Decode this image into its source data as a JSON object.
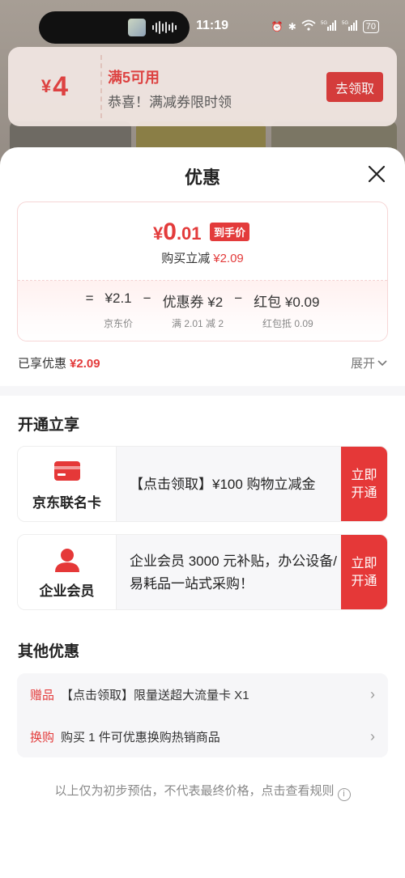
{
  "status_bar": {
    "time": "11:19",
    "battery": "70",
    "network_label": "5G"
  },
  "coupon_banner": {
    "currency": "¥",
    "amount": "4",
    "title": "满5可用",
    "subtitle": "恭喜！满减券限时领",
    "button": "去领取"
  },
  "sheet": {
    "title": "优惠",
    "price": {
      "currency": "¥",
      "integer": "0",
      "decimal": ".01",
      "tag": "到手价",
      "reduce_label": "购买立减",
      "reduce_value": "¥2.09"
    },
    "formula": {
      "eq": "=",
      "jd_price": "¥2.1",
      "minus1": "−",
      "coupon": "优惠券 ¥2",
      "minus2": "−",
      "redpacket": "红包 ¥0.09",
      "jd_price_label": "京东价",
      "coupon_label": "满 2.01 减 2",
      "redpacket_label": "红包抵 0.09"
    },
    "enjoyed": {
      "label": "已享优惠",
      "value": "¥2.09"
    },
    "expand": "展开",
    "open_section": {
      "title": "开通立享",
      "cards": [
        {
          "name": "京东联名卡",
          "desc": "【点击领取】¥100 购物立减金",
          "button": "立即开通"
        },
        {
          "name": "企业会员",
          "desc": "企业会员 3000 元补贴，办公设备/易耗品一站式采购！",
          "button": "立即开通"
        }
      ]
    },
    "other_section": {
      "title": "其他优惠",
      "rows": [
        {
          "tag": "赠品",
          "text": "【点击领取】限量送超大流量卡 X1"
        },
        {
          "tag": "换购",
          "text": "购买 1 件可优惠换购热销商品"
        }
      ]
    },
    "footer": "以上仅为初步预估，不代表最终价格，点击查看规则"
  },
  "colors": {
    "accent": "#e33b3b",
    "button_red": "#e53838"
  }
}
